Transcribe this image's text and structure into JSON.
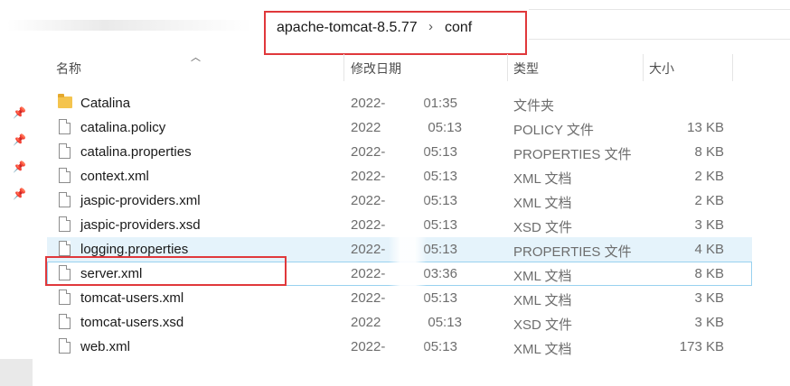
{
  "address_bar": {
    "path": [
      "apache-tomcat-8.5.77",
      "conf"
    ],
    "separator": "›"
  },
  "headers": {
    "name": "名称",
    "date": "修改日期",
    "type": "类型",
    "size": "大小"
  },
  "files": [
    {
      "name": "Catalina",
      "date": "2022-",
      "time": "01:35",
      "type": "文件夹",
      "size": "",
      "icon": "folder-icon"
    },
    {
      "name": "catalina.policy",
      "date": "2022",
      "time": "05:13",
      "type": "POLICY 文件",
      "size": "13 KB",
      "icon": "file-icon"
    },
    {
      "name": "catalina.properties",
      "date": "2022-",
      "time": "05:13",
      "type": "PROPERTIES 文件",
      "size": "8 KB",
      "icon": "file-icon"
    },
    {
      "name": "context.xml",
      "date": "2022-",
      "time": "05:13",
      "type": "XML 文档",
      "size": "2 KB",
      "icon": "file-icon"
    },
    {
      "name": "jaspic-providers.xml",
      "date": "2022-",
      "time": "05:13",
      "type": "XML 文档",
      "size": "2 KB",
      "icon": "file-icon"
    },
    {
      "name": "jaspic-providers.xsd",
      "date": "2022-",
      "time": "05:13",
      "type": "XSD 文件",
      "size": "3 KB",
      "icon": "file-icon"
    },
    {
      "name": "logging.properties",
      "date": "2022-",
      "time": "05:13",
      "type": "PROPERTIES 文件",
      "size": "4 KB",
      "icon": "file-icon"
    },
    {
      "name": "server.xml",
      "date": "2022-",
      "time": "03:36",
      "type": "XML 文档",
      "size": "8 KB",
      "icon": "file-icon"
    },
    {
      "name": "tomcat-users.xml",
      "date": "2022-",
      "time": "05:13",
      "type": "XML 文档",
      "size": "3 KB",
      "icon": "file-icon"
    },
    {
      "name": "tomcat-users.xsd",
      "date": "2022",
      "time": "05:13",
      "type": "XSD 文件",
      "size": "3 KB",
      "icon": "file-icon"
    },
    {
      "name": "web.xml",
      "date": "2022-",
      "time": "05:13",
      "type": "XML 文档",
      "size": "173 KB",
      "icon": "file-icon"
    }
  ],
  "colors": {
    "highlight_box": "#e0383b",
    "hover_row": "#e5f3fb",
    "selected_border": "#99d1ef",
    "folder": "#f4c44e"
  }
}
